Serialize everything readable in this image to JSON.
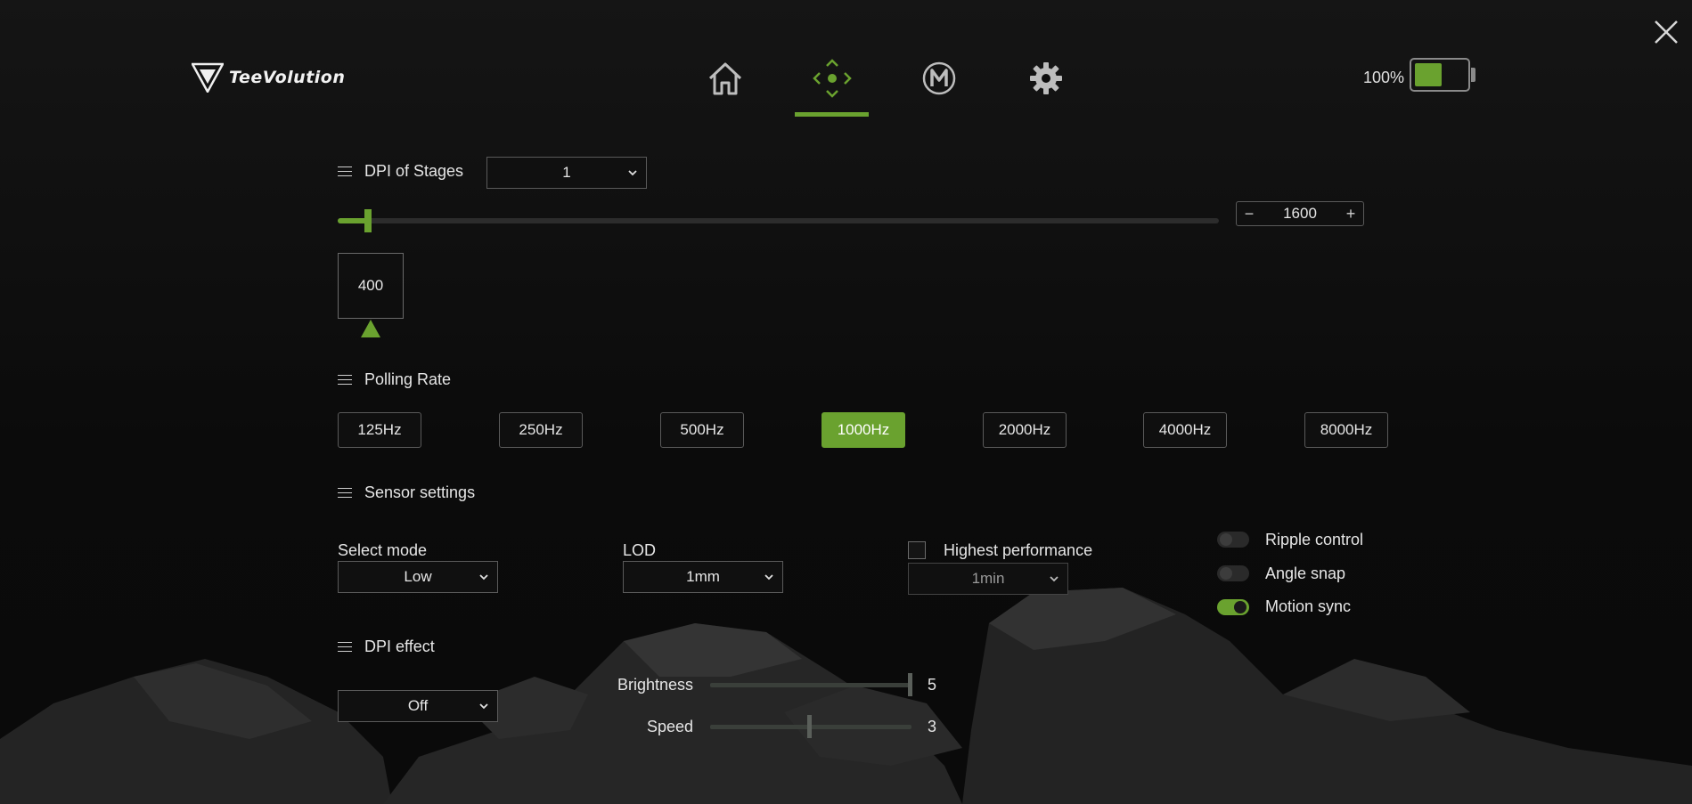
{
  "brand": {
    "name": "TeeVolution"
  },
  "nav": {
    "items": [
      {
        "name": "home",
        "icon": "home-icon",
        "active": false
      },
      {
        "name": "dpi",
        "icon": "crosshair-move-icon",
        "active": true
      },
      {
        "name": "macro",
        "icon": "macro-m-icon",
        "active": false
      },
      {
        "name": "settings",
        "icon": "gear-icon",
        "active": false
      }
    ]
  },
  "battery": {
    "percent_label": "100%",
    "level": 0.5
  },
  "colors": {
    "accent": "#6aa22f",
    "background": "#0d0d0d",
    "border": "#5a5a5a"
  },
  "dpi": {
    "stages_label": "DPI of Stages",
    "stages_value": "1",
    "stepper_minus": "−",
    "stepper_plus": "+",
    "value": "1600",
    "slider_fraction": 0.03,
    "stage_values": [
      "400"
    ]
  },
  "polling": {
    "title": "Polling Rate",
    "options": [
      "125Hz",
      "250Hz",
      "500Hz",
      "1000Hz",
      "2000Hz",
      "4000Hz",
      "8000Hz"
    ],
    "selected": "1000Hz"
  },
  "sensor": {
    "title": "Sensor settings",
    "mode_label": "Select mode",
    "mode_value": "Low",
    "lod_label": "LOD",
    "lod_value": "1mm",
    "highest_label": "Highest performance",
    "highest_checked": false,
    "highest_value": "1min",
    "toggles": [
      {
        "label": "Ripple control",
        "on": false
      },
      {
        "label": "Angle snap",
        "on": false
      },
      {
        "label": "Motion sync",
        "on": true
      }
    ]
  },
  "effect": {
    "title": "DPI effect",
    "value": "Off",
    "brightness_label": "Brightness",
    "brightness_value": "5",
    "speed_label": "Speed",
    "speed_value": "3"
  }
}
